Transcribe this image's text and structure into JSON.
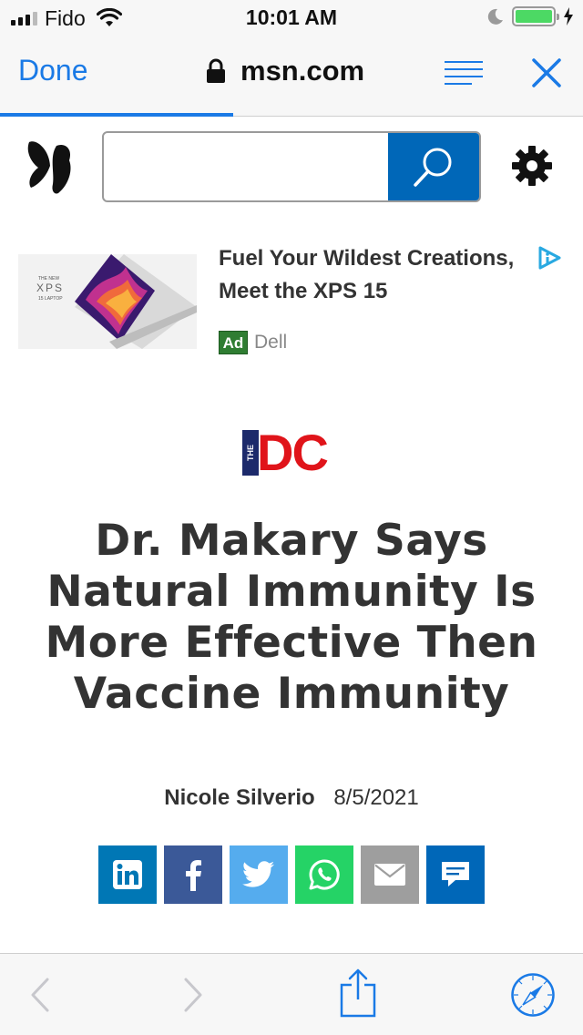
{
  "status_bar": {
    "carrier": "Fido",
    "time": "10:01 AM",
    "battery_level": 1.0,
    "icons": [
      "signal-icon",
      "wifi-icon",
      "moon-icon",
      "battery-icon",
      "charging-icon"
    ]
  },
  "nav": {
    "done_label": "Done",
    "url": "msn.com",
    "page_load_progress": 0.4,
    "accent_color": "#1a7ae6"
  },
  "msn": {
    "search_placeholder": "",
    "search_color": "#0067b8"
  },
  "ad": {
    "title": "Fuel Your Wildest Creations, Meet the XPS 15",
    "badge": "Ad",
    "source": "Dell",
    "image_text_small": "THE NEW",
    "image_text_brand": "XPS",
    "image_text_sub": "15 LAPTOP"
  },
  "publisher": {
    "the": "THE",
    "name": "DC"
  },
  "article": {
    "headline": "Dr. Makary Says Natural Immunity Is More Effective Then Vaccine Immunity",
    "author": "Nicole Silverio",
    "date": "8/5/2021"
  },
  "share_buttons": [
    {
      "icon": "linkedin-icon",
      "color": "#0077b5"
    },
    {
      "icon": "facebook-icon",
      "color": "#3b5998"
    },
    {
      "icon": "twitter-icon",
      "color": "#55acee"
    },
    {
      "icon": "whatsapp-icon",
      "color": "#25d366"
    },
    {
      "icon": "email-icon",
      "color": "#9e9e9e"
    },
    {
      "icon": "comment-icon",
      "color": "#0067b8"
    }
  ],
  "toolbar": {
    "icons": [
      "back-icon",
      "forward-icon",
      "share-icon",
      "compass-icon"
    ]
  }
}
